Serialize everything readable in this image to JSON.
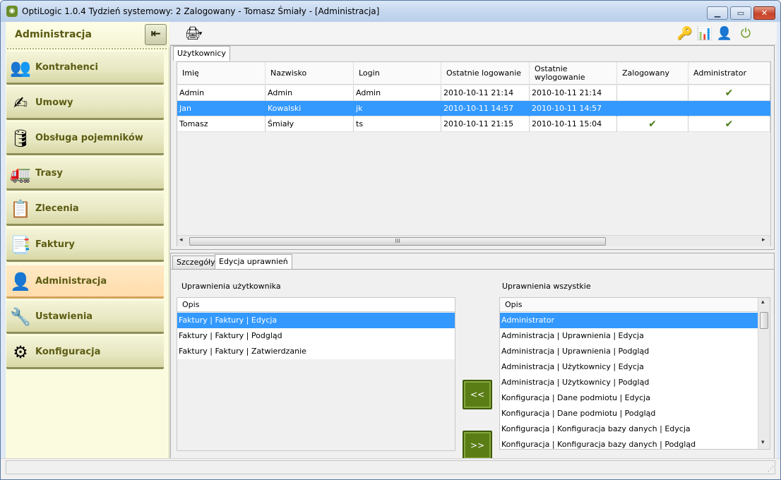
{
  "window": {
    "title": "OptiLogic 1.0.4  Tydzień systemowy: 2  Zalogowany - Tomasz Śmiały - [Administracja]",
    "minimize": "▁",
    "maximize": "▭",
    "close": "✕"
  },
  "sidebar": {
    "title": "Administracja",
    "collapse_icon": "⇤",
    "items": [
      {
        "label": "Kontrahenci",
        "icon": "👥"
      },
      {
        "label": "Umowy",
        "icon": "✍"
      },
      {
        "label": "Obsługa pojemników",
        "icon": "🛢"
      },
      {
        "label": "Trasy",
        "icon": "🚛"
      },
      {
        "label": "Zlecenia",
        "icon": "📋"
      },
      {
        "label": "Faktury",
        "icon": "📑"
      },
      {
        "label": "Administracja",
        "icon": "👤"
      },
      {
        "label": "Ustawienia",
        "icon": "🔧"
      },
      {
        "label": "Konfiguracja",
        "icon": "⚙"
      }
    ],
    "active": "Administracja"
  },
  "toolbar": {
    "print_icon": "🖨",
    "dropdown_icon": "▾",
    "right_icons": [
      "🔑",
      "📊",
      "👤",
      "⏻"
    ]
  },
  "users_tab": {
    "label": "Użytkownicy",
    "columns": [
      "Imię",
      "Nazwisko",
      "Login",
      "Ostatnie logowanie",
      "Ostatnie wylogowanie",
      "Zalogowany",
      "Administrator"
    ],
    "rows": [
      {
        "imie": "Admin",
        "nazwisko": "Admin",
        "login": "Admin",
        "logowanie": "2010-10-11 21:14",
        "wylogowanie": "2010-10-11 21:14",
        "zalogowany": "",
        "administrator": "✔"
      },
      {
        "imie": "Jan",
        "nazwisko": "Kowalski",
        "login": "jk",
        "logowanie": "2010-10-11 14:57",
        "wylogowanie": "2010-10-11 14:57",
        "zalogowany": "",
        "administrator": ""
      },
      {
        "imie": "Tomasz",
        "nazwisko": "Śmiały",
        "login": "ts",
        "logowanie": "2010-10-11 21:15",
        "wylogowanie": "2010-10-11 15:04",
        "zalogowany": "✔",
        "administrator": "✔"
      }
    ],
    "selected_row": 1,
    "scroll_left": "◂",
    "scroll_right": "▸",
    "scroll_grip": "III"
  },
  "details_tabs": {
    "tabs": [
      "Szczegóły",
      "Edycja uprawnień"
    ],
    "active": "Edycja uprawnień"
  },
  "permissions": {
    "user_label": "Uprawnienia użytkownika",
    "all_label": "Uprawnienia wszystkie",
    "column": "Opis",
    "user_items": [
      "Faktury | Faktury | Edycja",
      "Faktury | Faktury | Podgląd",
      "Faktury | Faktury | Zatwierdzanie"
    ],
    "all_items": [
      "Administrator",
      "Administracja | Uprawnienia | Edycja",
      "Administracja | Uprawnienia | Podgląd",
      "Administracja | Użytkownicy | Edycja",
      "Administracja | Użytkownicy | Podgląd",
      "Konfiguracja | Dane podmiotu | Edycja",
      "Konfiguracja | Dane podmiotu | Podgląd",
      "Konfiguracja | Konfiguracja bazy danych | Edycja",
      "Konfiguracja | Konfiguracja bazy danych | Podgląd"
    ],
    "add_button": "<<",
    "remove_button": ">>",
    "scroll_up": "▴",
    "scroll_down": "▾"
  },
  "colors": {
    "selection": "#3399ff",
    "sidebar_text": "#5c5c12",
    "active_nav": "#ffdcab",
    "button_green": "#5b7d16"
  }
}
